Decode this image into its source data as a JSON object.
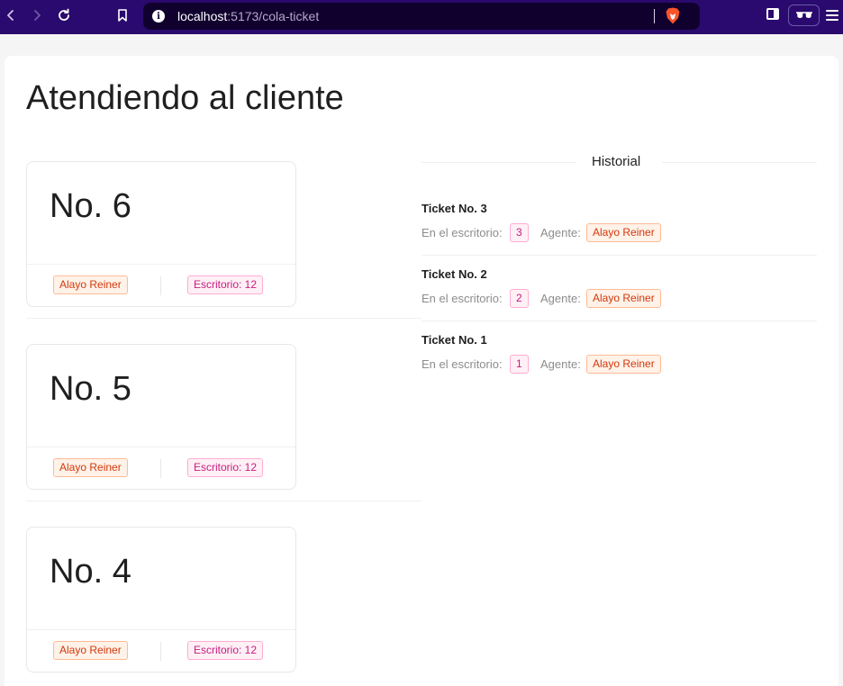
{
  "browser": {
    "url_host": "localhost",
    "url_path": ":5173/cola-ticket",
    "icons": [
      "back-icon",
      "forward-icon",
      "reload-icon",
      "bookmark-icon",
      "site-info-icon",
      "brave-shield-icon",
      "sidebar-icon",
      "private-glasses-icon",
      "menu-icon"
    ]
  },
  "page": {
    "title": "Atendiendo al cliente"
  },
  "tickets": [
    {
      "number": "No. 6",
      "agent": "Alayo Reiner",
      "desk": "Escritorio: 12"
    },
    {
      "number": "No. 5",
      "agent": "Alayo Reiner",
      "desk": "Escritorio: 12"
    },
    {
      "number": "No. 4",
      "agent": "Alayo Reiner",
      "desk": "Escritorio: 12"
    }
  ],
  "history": {
    "title": "Historial",
    "desk_label": "En el escritorio:",
    "agent_label": "Agente:",
    "items": [
      {
        "title": "Ticket No. 3",
        "desk": "3",
        "agent": "Alayo Reiner"
      },
      {
        "title": "Ticket No. 2",
        "desk": "2",
        "agent": "Alayo Reiner"
      },
      {
        "title": "Ticket No. 1",
        "desk": "1",
        "agent": "Alayo Reiner"
      }
    ]
  },
  "colors": {
    "browser_bar": "#2a0a6e",
    "tag_volcano": "#d4380d",
    "tag_magenta": "#c41d7f"
  }
}
